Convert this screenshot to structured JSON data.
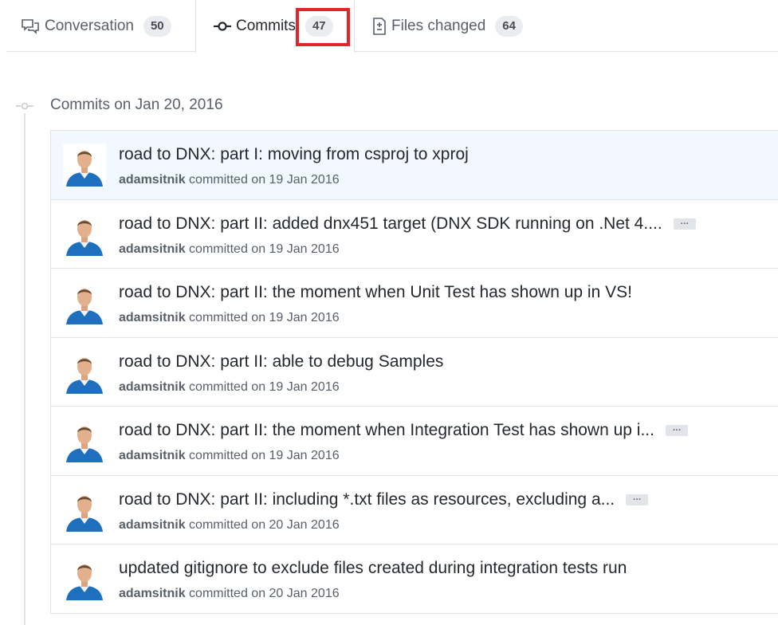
{
  "tabs": [
    {
      "label": "Conversation",
      "count": "50",
      "icon": "comment-discussion-icon"
    },
    {
      "label": "Commits",
      "count": "47",
      "icon": "git-commit-icon"
    },
    {
      "label": "Files changed",
      "count": "64",
      "icon": "file-diff-icon"
    }
  ],
  "timeline": {
    "group_title": "Commits on Jan 20, 2016"
  },
  "commits": [
    {
      "message": "road to DNX: part I: moving from csproj to xproj",
      "author": "adamsitnik",
      "action": "committed on 19 Jan 2016",
      "has_ellipsis": false
    },
    {
      "message": "road to DNX: part II: added dnx451 target (DNX SDK running on .Net 4....",
      "author": "adamsitnik",
      "action": "committed on 19 Jan 2016",
      "has_ellipsis": true
    },
    {
      "message": "road to DNX: part II: the moment when Unit Test has shown up in VS!",
      "author": "adamsitnik",
      "action": "committed on 19 Jan 2016",
      "has_ellipsis": false
    },
    {
      "message": "road to DNX: part II: able to debug Samples",
      "author": "adamsitnik",
      "action": "committed on 19 Jan 2016",
      "has_ellipsis": false
    },
    {
      "message": "road to DNX: part II: the moment when Integration Test has shown up i...",
      "author": "adamsitnik",
      "action": "committed on 19 Jan 2016",
      "has_ellipsis": true
    },
    {
      "message": "road to DNX: part II: including *.txt files as resources, excluding a...",
      "author": "adamsitnik",
      "action": "committed on 20 Jan 2016",
      "has_ellipsis": true
    },
    {
      "message": "updated gitignore to exclude files created during integration tests run",
      "author": "adamsitnik",
      "action": "committed on 20 Jan 2016",
      "has_ellipsis": false
    }
  ],
  "ellipsis_label": "…",
  "colors": {
    "highlight": "#e0262b",
    "selected_row": "#f1f8ff",
    "avatar_shirt": "#1f6fbf"
  }
}
